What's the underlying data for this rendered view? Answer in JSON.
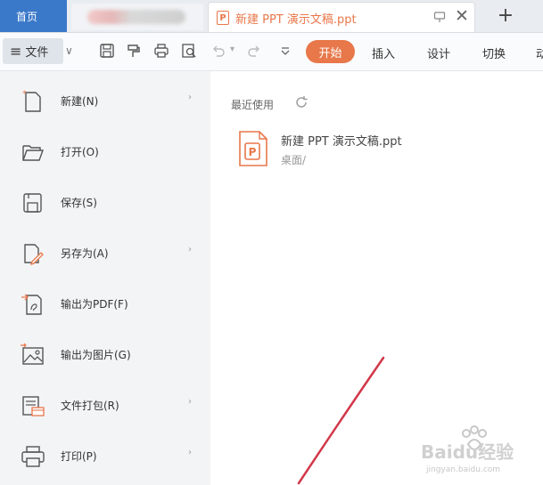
{
  "tabs": {
    "home_label": "首页",
    "doc_title": "新建 PPT 演示文稿.ppt",
    "doc_icon_letter": "P",
    "close_glyph": "✕",
    "new_tab_glyph": "+"
  },
  "toolbar": {
    "file_icon_glyph": "≡",
    "file_label": "文件",
    "file_arrow": "∨",
    "icons": [
      "save-icon",
      "format-painter-icon",
      "print-icon",
      "print-preview-icon",
      "undo-icon",
      "redo-icon",
      "more-icon"
    ],
    "ribbon_tabs": [
      "开始",
      "插入",
      "设计",
      "切换",
      "动"
    ],
    "accent_color": "#e8774a"
  },
  "menu": {
    "items": [
      {
        "label": "新建(N)",
        "icon": "new-file-icon",
        "has_submenu": true
      },
      {
        "label": "打开(O)",
        "icon": "folder-open-icon",
        "has_submenu": false
      },
      {
        "label": "保存(S)",
        "icon": "save-icon",
        "has_submenu": false
      },
      {
        "label": "另存为(A)",
        "icon": "save-as-icon",
        "has_submenu": true
      },
      {
        "label": "输出为PDF(F)",
        "icon": "export-pdf-icon",
        "has_submenu": false
      },
      {
        "label": "输出为图片(G)",
        "icon": "export-image-icon",
        "has_submenu": false
      },
      {
        "label": "文件打包(R)",
        "icon": "package-icon",
        "has_submenu": true
      },
      {
        "label": "打印(P)",
        "icon": "print-icon",
        "has_submenu": true
      }
    ],
    "chevron": "›"
  },
  "recent": {
    "title": "最近使用",
    "files": [
      {
        "name": "新建 PPT 演示文稿.ppt",
        "path": "桌面/",
        "icon_letter": "P"
      }
    ]
  },
  "watermark": {
    "brand": "Baidu经验",
    "url": "jingyan.baidu.com"
  }
}
